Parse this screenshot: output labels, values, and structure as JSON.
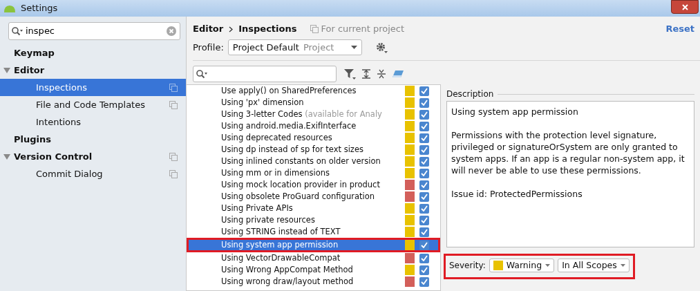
{
  "window": {
    "title": "Settings"
  },
  "sidebar": {
    "search": {
      "value": "inspec"
    },
    "tree": [
      {
        "label": "Keymap",
        "selected": false,
        "project_icon": false
      },
      {
        "label": "Editor",
        "selected": false,
        "project_icon": false,
        "expanded": true,
        "children": [
          {
            "label": "Inspections",
            "selected": true,
            "project_icon": true
          },
          {
            "label": "File and Code Templates",
            "selected": false,
            "project_icon": true
          },
          {
            "label": "Intentions",
            "selected": false,
            "project_icon": false
          }
        ]
      },
      {
        "label": "Plugins",
        "selected": false,
        "project_icon": false
      },
      {
        "label": "Version Control",
        "selected": false,
        "project_icon": true,
        "expanded": true,
        "children": [
          {
            "label": "Commit Dialog",
            "selected": false,
            "project_icon": true
          }
        ]
      }
    ]
  },
  "header": {
    "breadcrumb": [
      "Editor",
      "Inspections"
    ],
    "scope_note": "For current project",
    "reset": "Reset"
  },
  "profile": {
    "label": "Profile:",
    "value": "Project Default",
    "scope": "Project"
  },
  "inspections": [
    {
      "label": "Use apply() on SharedPreferences",
      "color": "#e8c200",
      "checked": true,
      "selected": false,
      "highlighted": false
    },
    {
      "label": "Using 'px' dimension",
      "color": "#e8c200",
      "checked": true,
      "selected": false,
      "highlighted": false
    },
    {
      "label": "Using 3-letter Codes",
      "note": "(available for Analy",
      "color": "#e8c200",
      "checked": true,
      "selected": false,
      "highlighted": false
    },
    {
      "label": "Using android.media.ExifInterface",
      "color": "#e8c200",
      "checked": true,
      "selected": false,
      "highlighted": false
    },
    {
      "label": "Using deprecated resources",
      "color": "#e8c200",
      "checked": true,
      "selected": false,
      "highlighted": false
    },
    {
      "label": "Using dp instead of sp for text sizes",
      "color": "#e8c200",
      "checked": true,
      "selected": false,
      "highlighted": false
    },
    {
      "label": "Using inlined constants on older version",
      "color": "#e8c200",
      "checked": true,
      "selected": false,
      "highlighted": false
    },
    {
      "label": "Using mm or in dimensions",
      "color": "#e8c200",
      "checked": true,
      "selected": false,
      "highlighted": false
    },
    {
      "label": "Using mock location provider in product",
      "color": "#d35f5a",
      "checked": true,
      "selected": false,
      "highlighted": false
    },
    {
      "label": "Using obsolete ProGuard configuration",
      "color": "#d35f5a",
      "checked": true,
      "selected": false,
      "highlighted": false
    },
    {
      "label": "Using Private APIs",
      "color": "#e8c200",
      "checked": true,
      "selected": false,
      "highlighted": false
    },
    {
      "label": "Using private resources",
      "color": "#e8c200",
      "checked": true,
      "selected": false,
      "highlighted": false
    },
    {
      "label": "Using STRING instead of TEXT",
      "color": "#e8c200",
      "checked": true,
      "selected": false,
      "highlighted": false
    },
    {
      "label": "Using system app permission",
      "color": "#e8c200",
      "checked": true,
      "selected": true,
      "highlighted": true
    },
    {
      "label": "Using VectorDrawableCompat",
      "color": "#d35f5a",
      "checked": true,
      "selected": false,
      "highlighted": false
    },
    {
      "label": "Using Wrong AppCompat Method",
      "color": "#e8c200",
      "checked": true,
      "selected": false,
      "highlighted": false
    },
    {
      "label": "Using wrong draw/layout method",
      "color": "#d35f5a",
      "checked": true,
      "selected": false,
      "highlighted": false
    }
  ],
  "description": {
    "title": "Description",
    "paragraphs": [
      "Using system app permission",
      "Permissions with the protection level signature, privileged or signatureOrSystem are only granted to system apps. If an app is a regular non-system app, it will never be able to use these permissions.",
      "Issue id: ProtectedPermissions"
    ]
  },
  "severity": {
    "label": "Severity:",
    "value": "Warning",
    "color": "#e8c200",
    "scope": "In All Scopes",
    "highlighted": true
  }
}
